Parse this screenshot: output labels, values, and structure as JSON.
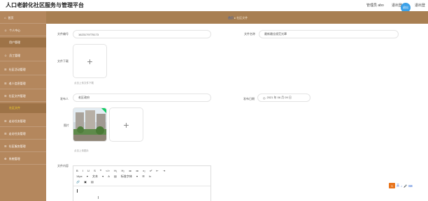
{
  "header": {
    "title": "人口老龄化社区服务与管理平台",
    "admin": "管理员 abo",
    "logout1": "退出登",
    "avatar_text": "退出",
    "logout2": "退出登"
  },
  "breadcrumb": {
    "home": "首页",
    "sep": "▸",
    "current": "社区文件"
  },
  "sidebar": {
    "items": [
      {
        "icon": "home-icon",
        "label": "首页"
      },
      {
        "icon": "user-icon",
        "label": "个人中心"
      },
      {
        "label": "用户管理"
      },
      {
        "icon": "staff-icon",
        "label": "员工管理"
      },
      {
        "icon": "menu-icon",
        "label": "社区活动管理"
      },
      {
        "icon": "menu-icon",
        "label": "老人信息管理"
      },
      {
        "icon": "menu-icon",
        "label": "社区文件管理"
      },
      {
        "label": "社区文件"
      },
      {
        "icon": "menu-icon",
        "label": "走访任务管理"
      },
      {
        "icon": "menu-icon",
        "label": "走访任务管理"
      },
      {
        "icon": "menu-icon",
        "label": "社区服务管理"
      },
      {
        "icon": "gear-icon",
        "label": "系统管理"
      }
    ]
  },
  "form": {
    "file_no_label": "文件编号",
    "file_no_value": "1623179775173",
    "file_name_label": "文件名称",
    "file_name_value": "最新最佳规范光罩",
    "file_download_label": "文件下载",
    "upload_plus": "+",
    "file_hint": "点击上传文件下载",
    "publisher_label": "发布人",
    "publisher_value": "老区政府",
    "publish_date_label": "发布日期",
    "publish_date_value": "2021 年 06 月 09 日",
    "image_label": "图片",
    "image_hint": "点击上传图片",
    "content_label": "文件内容"
  },
  "editor": {
    "toolbar_row1": [
      "B",
      "I",
      "U",
      "S",
      "❝",
      "</>",
      "H₁",
      "H₂",
      "≔",
      "≔",
      "x₂",
      "x²",
      "⇤",
      "⇥"
    ],
    "toolbar_row2": [
      "14px",
      "▾",
      "文本",
      "▾",
      "A",
      "▤",
      "标准字体",
      "▾",
      "☰",
      "Ix"
    ],
    "toolbar_row3": [
      "🔗",
      "▣",
      "▤"
    ]
  },
  "tray": {
    "box_label": "S",
    "icons": [
      "英",
      "♪",
      "🎤",
      "⌨"
    ]
  }
}
